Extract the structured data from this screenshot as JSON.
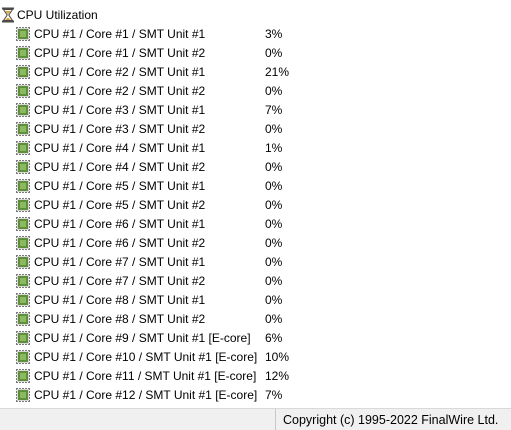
{
  "group": {
    "label": "CPU Utilization",
    "icon": "hourglass-icon"
  },
  "rows": [
    {
      "name": "CPU #1 / Core #1 / SMT Unit #1",
      "value": "3%"
    },
    {
      "name": "CPU #1 / Core #1 / SMT Unit #2",
      "value": "0%"
    },
    {
      "name": "CPU #1 / Core #2 / SMT Unit #1",
      "value": "21%"
    },
    {
      "name": "CPU #1 / Core #2 / SMT Unit #2",
      "value": "0%"
    },
    {
      "name": "CPU #1 / Core #3 / SMT Unit #1",
      "value": "7%"
    },
    {
      "name": "CPU #1 / Core #3 / SMT Unit #2",
      "value": "0%"
    },
    {
      "name": "CPU #1 / Core #4 / SMT Unit #1",
      "value": "1%"
    },
    {
      "name": "CPU #1 / Core #4 / SMT Unit #2",
      "value": "0%"
    },
    {
      "name": "CPU #1 / Core #5 / SMT Unit #1",
      "value": "0%"
    },
    {
      "name": "CPU #1 / Core #5 / SMT Unit #2",
      "value": "0%"
    },
    {
      "name": "CPU #1 / Core #6 / SMT Unit #1",
      "value": "0%"
    },
    {
      "name": "CPU #1 / Core #6 / SMT Unit #2",
      "value": "0%"
    },
    {
      "name": "CPU #1 / Core #7 / SMT Unit #1",
      "value": "0%"
    },
    {
      "name": "CPU #1 / Core #7 / SMT Unit #2",
      "value": "0%"
    },
    {
      "name": "CPU #1 / Core #8 / SMT Unit #1",
      "value": "0%"
    },
    {
      "name": "CPU #1 / Core #8 / SMT Unit #2",
      "value": "0%"
    },
    {
      "name": "CPU #1 / Core #9 / SMT Unit #1 [E-core]",
      "value": "6%"
    },
    {
      "name": "CPU #1 / Core #10 / SMT Unit #1 [E-core]",
      "value": "10%"
    },
    {
      "name": "CPU #1 / Core #11 / SMT Unit #1 [E-core]",
      "value": "12%"
    },
    {
      "name": "CPU #1 / Core #12 / SMT Unit #1 [E-core]",
      "value": "7%"
    }
  ],
  "row_icon": "cpu-chip-icon",
  "statusbar": {
    "left": "",
    "right": "Copyright (c) 1995-2022 FinalWire Ltd."
  },
  "colors": {
    "chip_body": "#5f8f3c",
    "chip_pins": "#6b6b6b",
    "hourglass_frame": "#4a4a4a",
    "hourglass_sand": "#d9a441",
    "statusbar_bg": "#f0f0f0"
  }
}
